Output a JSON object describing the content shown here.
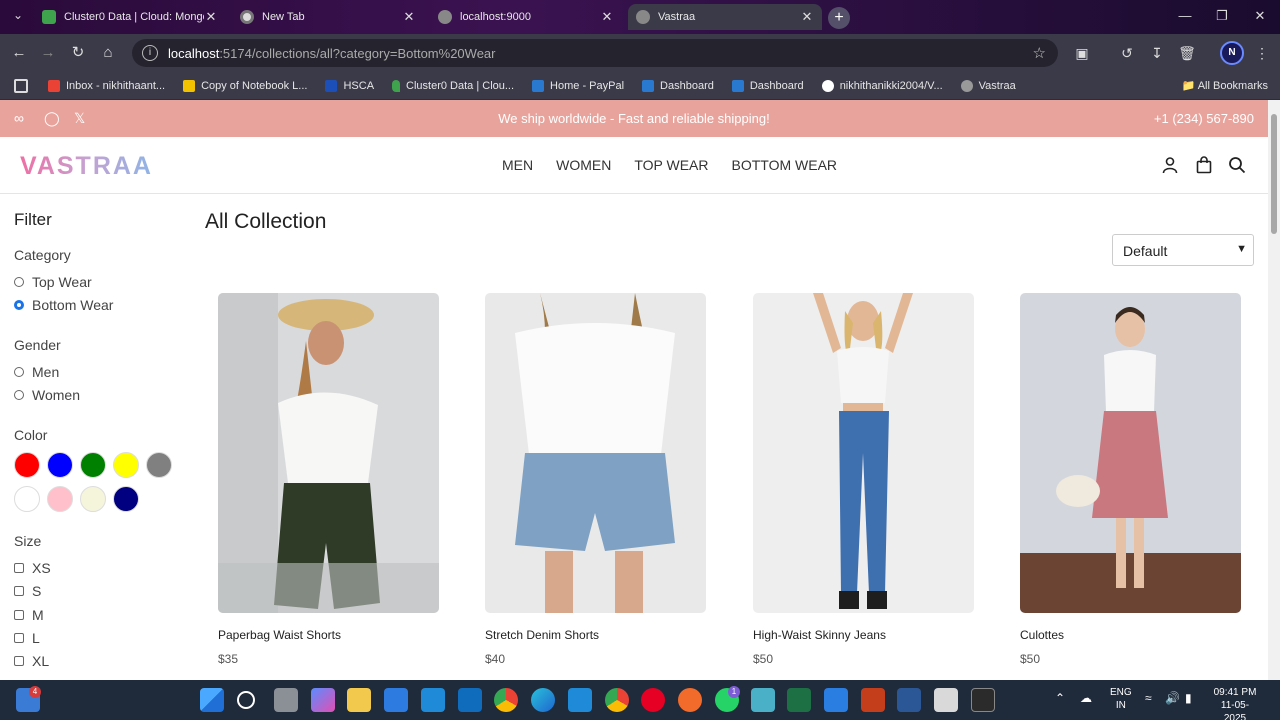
{
  "browser": {
    "tabs": [
      {
        "title": "Cluster0 Data | Cloud: MongoDB",
        "favicon": "mongodb-leaf-icon"
      },
      {
        "title": "New Tab",
        "favicon": "chrome-icon"
      },
      {
        "title": "localhost:9000",
        "favicon": "globe-icon"
      },
      {
        "title": "Vastraa",
        "favicon": "globe-icon"
      }
    ],
    "url_host": "localhost",
    "url_rest": ":5174/collections/all?category=Bottom%20Wear",
    "profile_initial": "N",
    "bookmarks": [
      {
        "label": "Inbox - nikhithaant...",
        "icon": "gmail-icon"
      },
      {
        "label": "Copy of Notebook L...",
        "icon": "folder-icon"
      },
      {
        "label": "HSCA",
        "icon": "hs-icon"
      },
      {
        "label": "Cluster0 Data | Clou...",
        "icon": "mongodb-leaf-icon"
      },
      {
        "label": "Home - PayPal",
        "icon": "paypal-icon"
      },
      {
        "label": "Dashboard",
        "icon": "paypal-icon"
      },
      {
        "label": "Dashboard",
        "icon": "paypal-icon"
      },
      {
        "label": "nikhithanikki2004/V...",
        "icon": "github-icon"
      },
      {
        "label": "Vastraa",
        "icon": "globe-icon"
      }
    ],
    "all_bookmarks": "All Bookmarks"
  },
  "promo": {
    "message": "We ship worldwide - Fast and reliable shipping!",
    "phone": "+1 (234) 567-890"
  },
  "header": {
    "logo": "VASTRAA",
    "nav": [
      "MEN",
      "WOMEN",
      "TOP WEAR",
      "BOTTOM WEAR"
    ]
  },
  "filter": {
    "title": "Filter",
    "category_label": "Category",
    "categories": [
      {
        "label": "Top Wear",
        "selected": false
      },
      {
        "label": "Bottom Wear",
        "selected": true
      }
    ],
    "gender_label": "Gender",
    "genders": [
      "Men",
      "Women"
    ],
    "color_label": "Color",
    "colors": [
      "#ff0000",
      "#0000ff",
      "#008000",
      "#ffff00",
      "#808080",
      "#ffffff",
      "#ffc0cb",
      "#f5f5dc",
      "#000080"
    ],
    "size_label": "Size",
    "sizes": [
      "XS",
      "S",
      "M",
      "L",
      "XL"
    ]
  },
  "collection": {
    "title": "All Collection",
    "sort_value": "Default",
    "products": [
      {
        "name": "Paperbag Waist Shorts",
        "price": "$35"
      },
      {
        "name": "Stretch Denim Shorts",
        "price": "$40"
      },
      {
        "name": "High-Waist Skinny Jeans",
        "price": "$50"
      },
      {
        "name": "Culottes",
        "price": "$50"
      }
    ]
  },
  "taskbar": {
    "lang_line1": "ENG",
    "lang_line2": "IN",
    "time": "09:41 PM",
    "date": "11-05-2025",
    "store_badge": "4",
    "whatsapp_badge": "1"
  }
}
